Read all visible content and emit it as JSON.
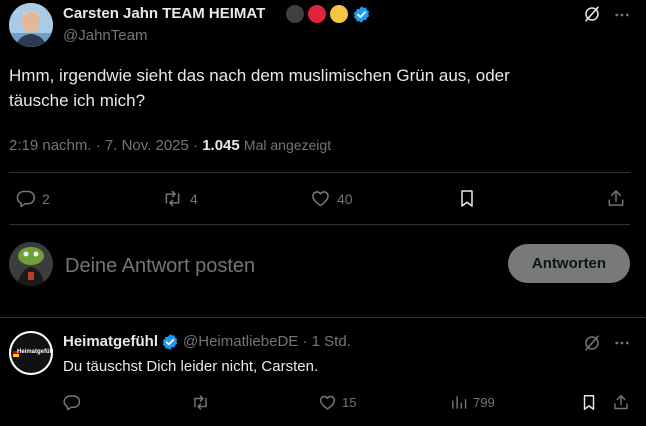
{
  "tweet": {
    "author_name": "Carsten Jahn TEAM HEIMAT",
    "author_handle": "@JahnTeam",
    "badge_colors": [
      "#3d3f42",
      "#e0243a",
      "#f4c542"
    ],
    "verified_color": "#1d9bf0",
    "text_line1": "Hmm, irgendwie sieht das nach dem muslimischen Grün aus, oder",
    "text_line2": "täusche ich mich?",
    "time": "2:19 nachm.",
    "date": "7. Nov. 2025",
    "views_count": "1.045",
    "views_label": "Mal angezeigt",
    "replies": "2",
    "reposts": "4",
    "likes": "40"
  },
  "compose": {
    "placeholder": "Deine Antwort posten",
    "button_label": "Antworten"
  },
  "reply": {
    "author_name": "Heimatgefühl",
    "author_handle": "@HeimatliebeDE",
    "time": "1 Std.",
    "text": "Du täuschst Dich leider nicht, Carsten.",
    "avatar_text": "Heimatgefühl",
    "likes": "15",
    "views": "799"
  },
  "icons": [
    "grok-icon",
    "more-icon",
    "reply-icon",
    "repost-icon",
    "like-icon",
    "bookmark-icon",
    "share-icon",
    "views-icon",
    "verified-icon"
  ]
}
